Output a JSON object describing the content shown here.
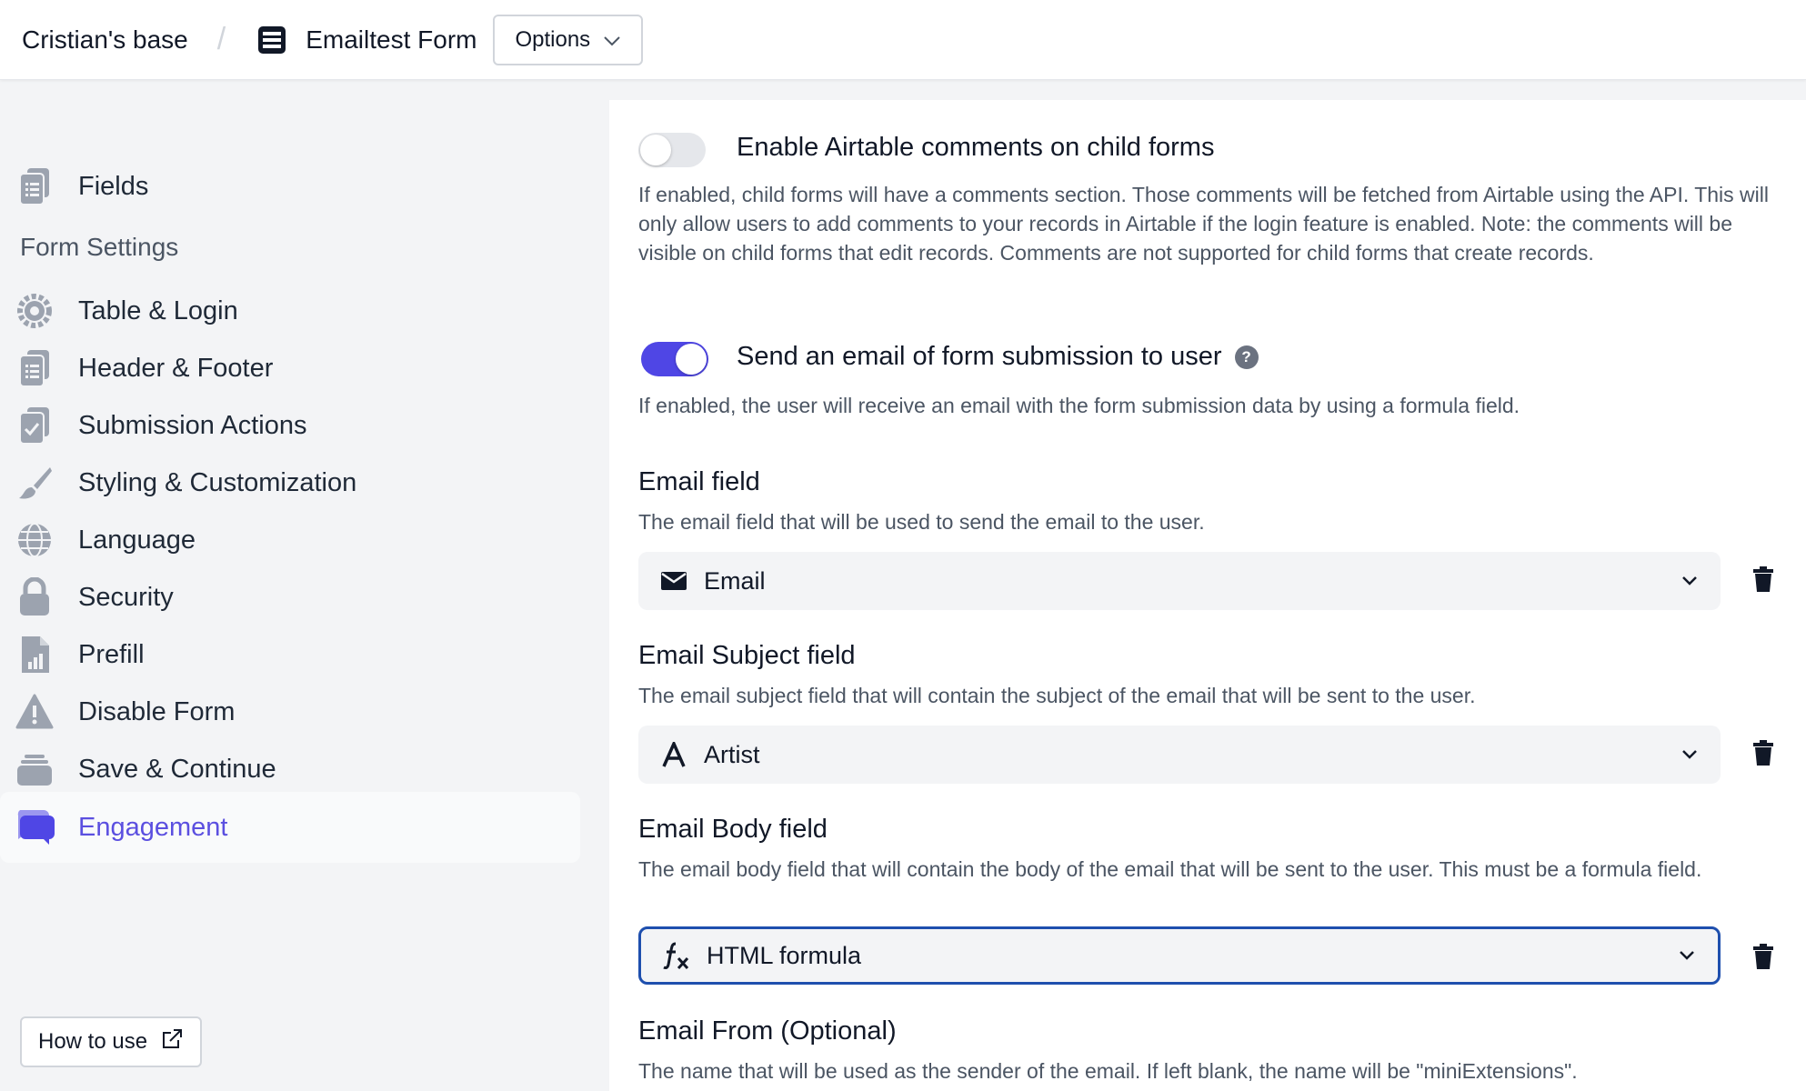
{
  "topbar": {
    "base_name": "Cristian's base",
    "separator": "/",
    "form_name": "Emailtest Form",
    "options_label": "Options"
  },
  "sidebar": {
    "fields_label": "Fields",
    "section_label": "Form Settings",
    "items": [
      {
        "label": "Table & Login",
        "icon": "gear-icon"
      },
      {
        "label": "Header & Footer",
        "icon": "clipboard-icon"
      },
      {
        "label": "Submission Actions",
        "icon": "clipboard-check-icon"
      },
      {
        "label": "Styling & Customization",
        "icon": "paintbrush-icon"
      },
      {
        "label": "Language",
        "icon": "globe-icon"
      },
      {
        "label": "Security",
        "icon": "lock-icon"
      },
      {
        "label": "Prefill",
        "icon": "file-chart-icon"
      },
      {
        "label": "Disable Form",
        "icon": "warning-icon"
      },
      {
        "label": "Save & Continue",
        "icon": "layers-icon"
      },
      {
        "label": "Engagement",
        "icon": "chat-bubbles-icon",
        "active": true
      }
    ],
    "how_to_use_label": "How to use"
  },
  "settings": {
    "comments": {
      "enabled": false,
      "title": "Enable Airtable comments on child forms",
      "description": "If enabled, child forms will have a comments section. Those comments will be fetched from Airtable using the API. This will only allow users to add comments to your records in Airtable if the login feature is enabled. Note: the comments will be visible on child forms that edit records. Comments are not supported for child forms that create records."
    },
    "send_email": {
      "enabled": true,
      "title": "Send an email of form submission to user",
      "help": "?",
      "description": "If enabled, the user will receive an email with the form submission data by using a formula field."
    },
    "email_field": {
      "title": "Email field",
      "description": "The email field that will be used to send the email to the user.",
      "value": "Email",
      "icon": "envelope-icon"
    },
    "email_subject_field": {
      "title": "Email Subject field",
      "description": "The email subject field that will contain the subject of the email that will be sent to the user.",
      "value": "Artist",
      "icon": "text-a-icon"
    },
    "email_body_field": {
      "title": "Email Body field",
      "description": "The email body field that will contain the body of the email that will be sent to the user. This must be a formula field.",
      "value": "HTML formula",
      "icon": "formula-fx-icon"
    },
    "email_from": {
      "title": "Email From (Optional)",
      "description": "The name that will be used as the sender of the email. If left blank, the name will be \"miniExtensions\"."
    }
  },
  "colors": {
    "accent": "#4f46e5",
    "active_text": "#5b4fe0",
    "focus_border": "#1e4fae"
  }
}
